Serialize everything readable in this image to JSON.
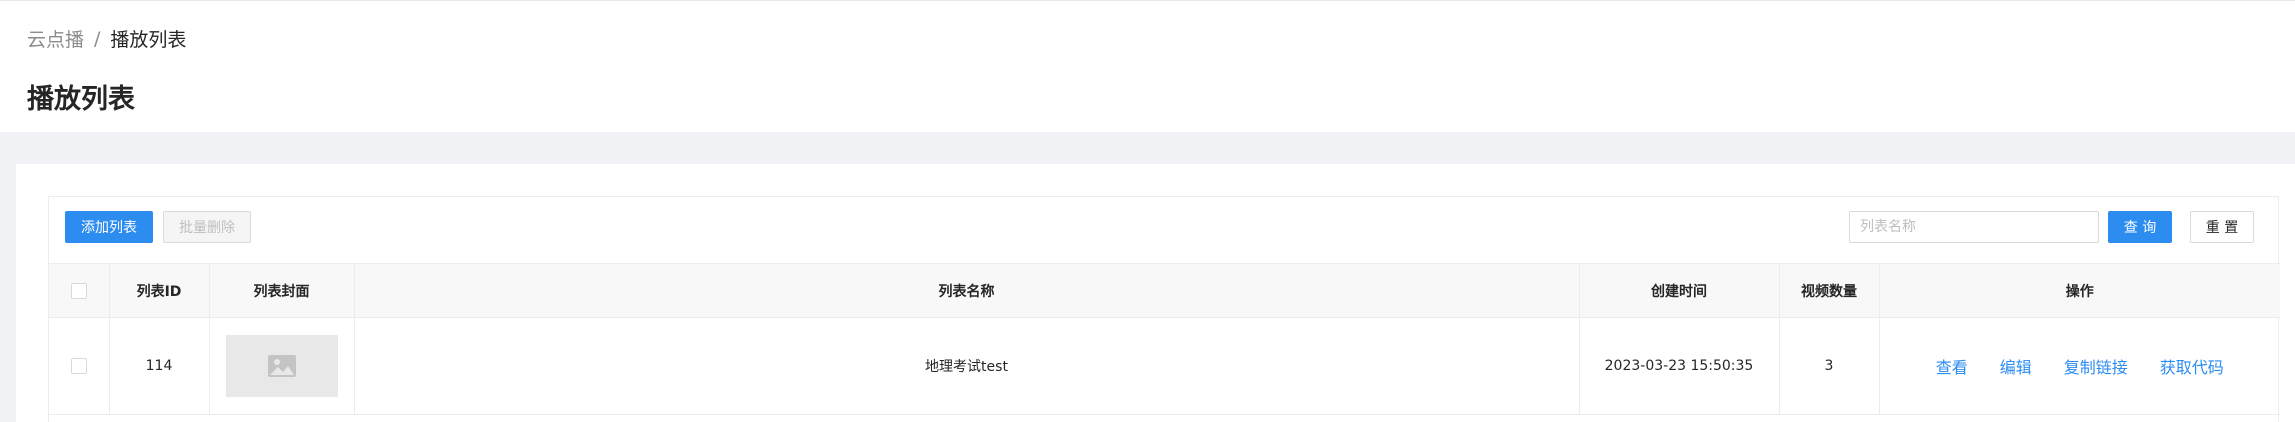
{
  "breadcrumb": {
    "root": "云点播",
    "separator": "/",
    "current": "播放列表"
  },
  "page": {
    "title": "播放列表"
  },
  "toolbar": {
    "add_label": "添加列表",
    "batch_delete_label": "批量删除",
    "search_placeholder": "列表名称",
    "search_value": "",
    "query_label": "查 询",
    "reset_label": "重 置"
  },
  "table": {
    "columns": [
      "列表ID",
      "列表封面",
      "列表名称",
      "创建时间",
      "视频数量",
      "操作"
    ],
    "rows": [
      {
        "id": "114",
        "cover": "image-placeholder-icon",
        "name": "地理考试test",
        "created": "2023-03-23 15:50:35",
        "count": "3",
        "actions": [
          "查看",
          "编辑",
          "复制链接",
          "获取代码"
        ]
      }
    ]
  },
  "colors": {
    "primary": "#2d8cf0",
    "background": "#f0f2f5",
    "header_bg": "#f8f8f9"
  }
}
